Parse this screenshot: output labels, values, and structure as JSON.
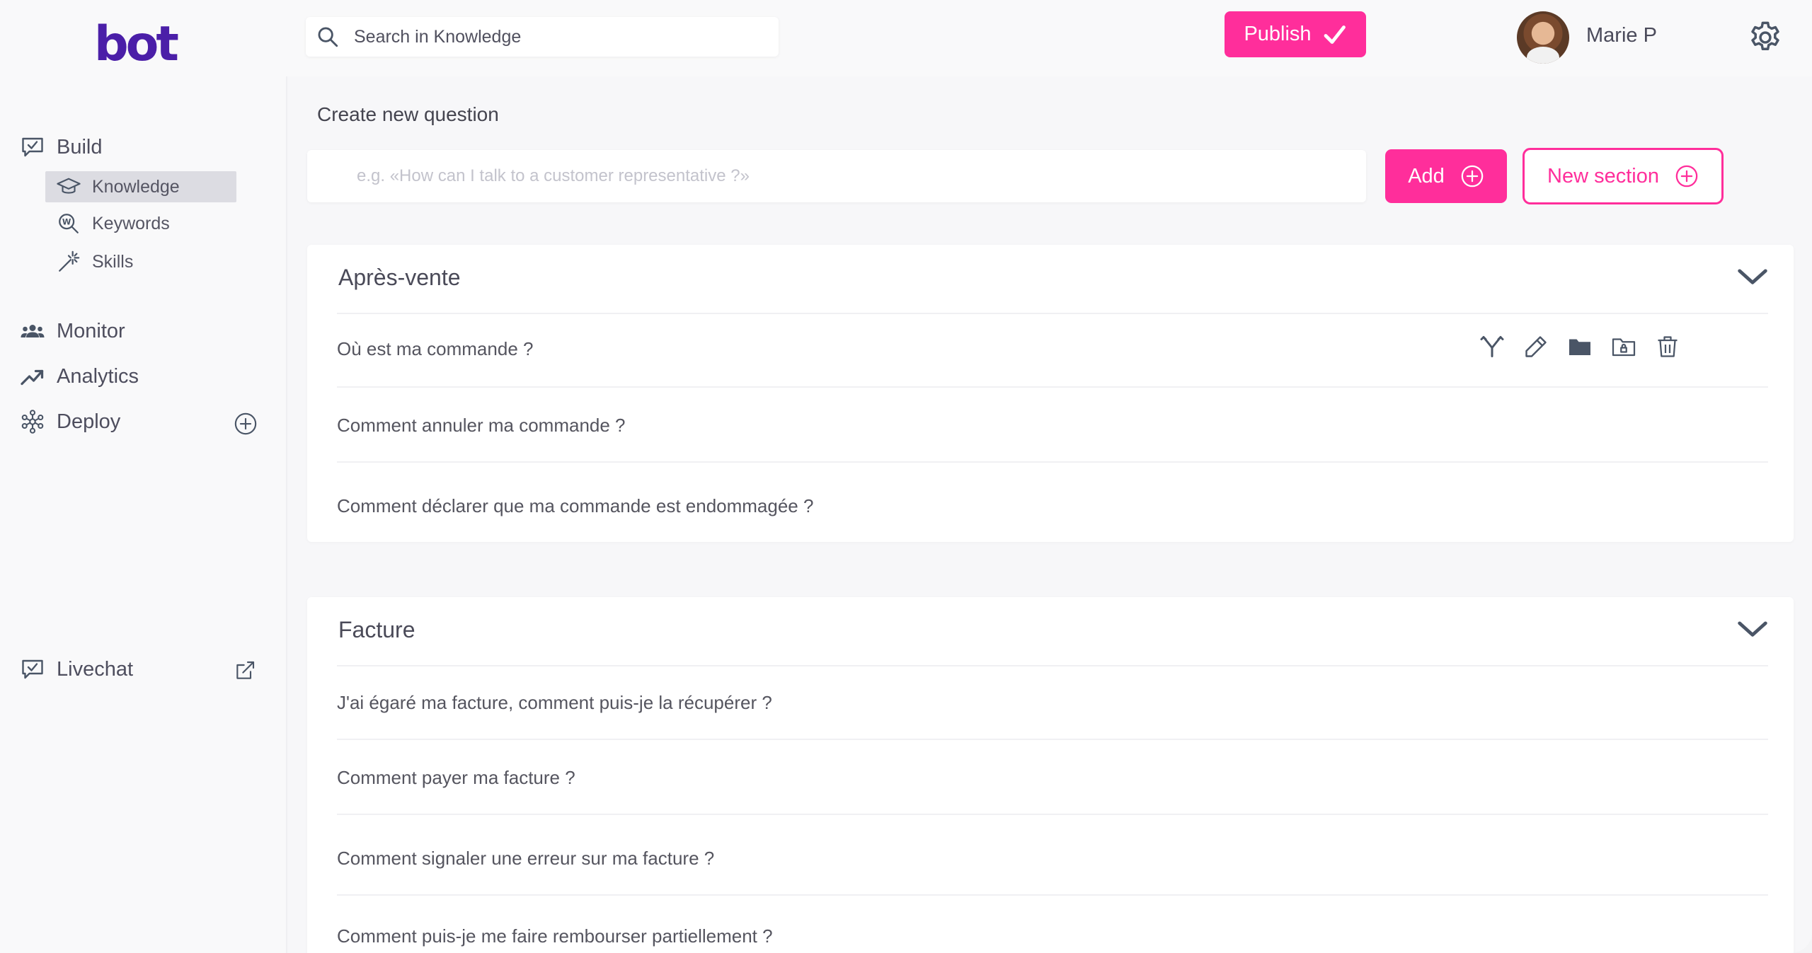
{
  "header": {
    "logo_text": "bot",
    "search_placeholder": "Search in Knowledge",
    "publish_label": "Publish",
    "user_name": "Marie P"
  },
  "sidebar": {
    "build": "Build",
    "knowledge": "Knowledge",
    "keywords": "Keywords",
    "skills": "Skills",
    "monitor": "Monitor",
    "analytics": "Analytics",
    "deploy": "Deploy",
    "livechat": "Livechat"
  },
  "main": {
    "create_heading": "Create new question",
    "question_placeholder": "e.g. «How can I talk to a customer representative ?»",
    "add_label": "Add",
    "new_section_label": "New section",
    "sections": [
      {
        "title": "Après-vente",
        "questions": [
          "Où est ma commande ?",
          "Comment annuler ma commande ?",
          "Comment déclarer que ma commande est endommagée ?"
        ]
      },
      {
        "title": "Facture",
        "questions": [
          "J'ai égaré ma facture, comment puis-je la récupérer ?",
          "Comment payer ma facture ?",
          "Comment signaler une erreur sur ma facture ?",
          "Comment puis-je me faire rembourser partiellement ?"
        ]
      }
    ]
  },
  "colors": {
    "accent": "#ff2e9b",
    "brand": "#4b1fa8",
    "icon": "#4a5566"
  },
  "icons": [
    "search-icon",
    "checkmark-icon",
    "gear-icon",
    "chat-check-icon",
    "graduation-cap-icon",
    "keyword-search-icon",
    "magic-wand-icon",
    "users-icon",
    "trend-up-icon",
    "network-icon",
    "plus-circle-icon",
    "external-link-icon",
    "chevron-down-icon",
    "branch-icon",
    "pencil-icon",
    "folder-icon",
    "folder-lock-icon",
    "trash-icon"
  ]
}
